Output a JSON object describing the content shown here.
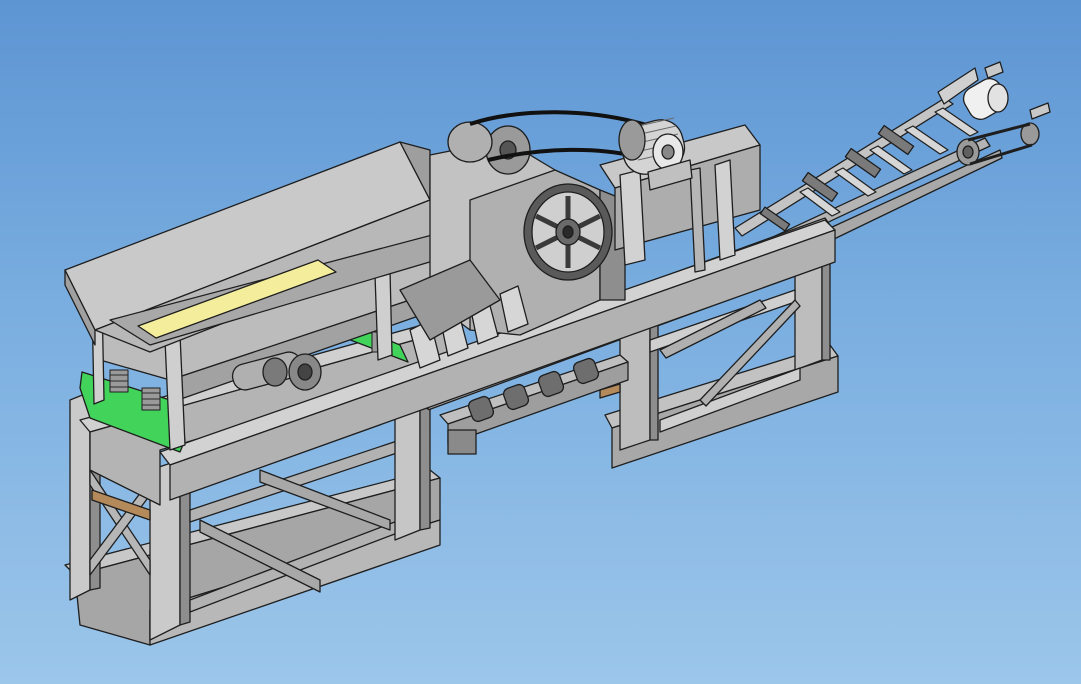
{
  "scene": {
    "subject": "",
    "colors": {
      "background_top": "#5d95d3",
      "background_bottom": "#9cc6ea",
      "steel": "#c4c4c4",
      "steel_dark": "#8e8e8e",
      "steel_light": "#e0e0e0",
      "outline": "#1e1e1e",
      "green_mount": "#42d35a",
      "yellow_panel": "#f4ee9c",
      "wood_strip": "#b48a5a",
      "wheel_dark": "#5a5a5a"
    },
    "components": [
      "feed-hopper",
      "vibrating-screen",
      "jaw-crusher",
      "flywheel",
      "electric-motor",
      "drive-belt",
      "main-frame",
      "discharge-conveyor",
      "belt-conveyor",
      "head-pulley"
    ]
  }
}
